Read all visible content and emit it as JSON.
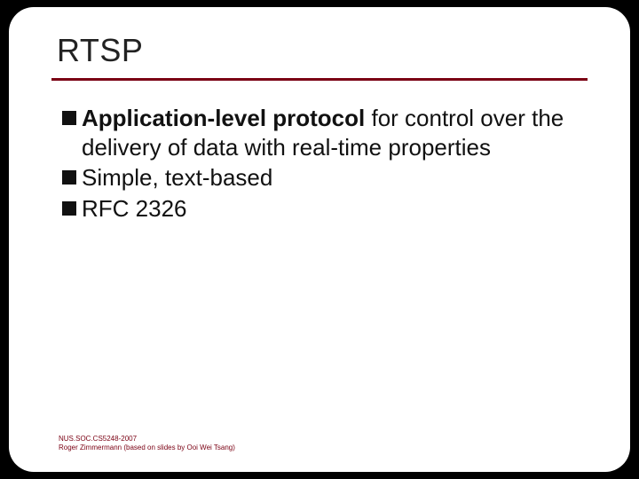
{
  "title": "RTSP",
  "bullets": {
    "b1_bold": "Application-level protocol",
    "b1_rest": " for control over the delivery of data with real-time properties",
    "b2": "Simple, text-based",
    "b3": "RFC 2326"
  },
  "footer": {
    "line1": "NUS.SOC.CS5248-2007",
    "line2": "Roger Zimmermann (based on slides by Ooi Wei Tsang)"
  }
}
